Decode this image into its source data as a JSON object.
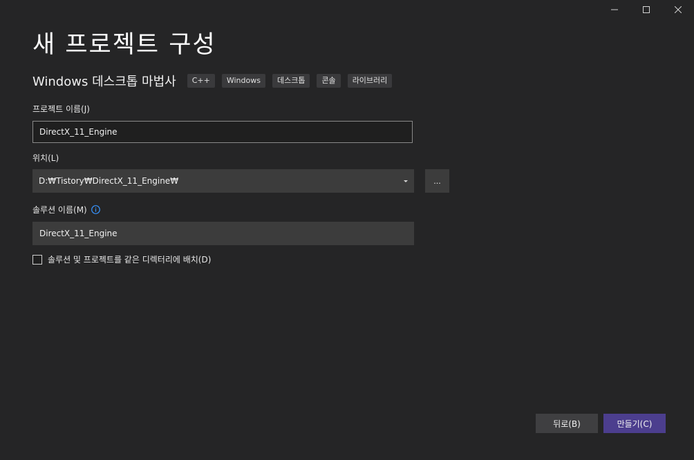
{
  "window": {
    "controls": [
      "minimize-icon",
      "maximize-icon",
      "close-icon"
    ]
  },
  "page": {
    "title": "새 프로젝트 구성"
  },
  "template": {
    "name": "Windows 데스크톱 마법사",
    "tags": [
      "C++",
      "Windows",
      "데스크톱",
      "콘솔",
      "라이브러리"
    ]
  },
  "form": {
    "project_name_label": "프로젝트 이름(J)",
    "project_name_value": "DirectX_11_Engine",
    "location_label": "위치(L)",
    "location_value": "D:₩Tistory₩DirectX_11_Engine₩",
    "browse_label": "...",
    "solution_name_label": "솔루션 이름(M)",
    "solution_name_value": "DirectX_11_Engine",
    "same_dir_checkbox_label": "솔루션 및 프로젝트를 같은 디렉터리에 배치(D)",
    "same_dir_checked": false
  },
  "footer": {
    "back_label": "뒤로(B)",
    "create_label": "만들기(C)"
  },
  "colors": {
    "background": "#252526",
    "input": "#3c3c3c",
    "accent": "#4c3e8e",
    "info": "#3794ff"
  }
}
